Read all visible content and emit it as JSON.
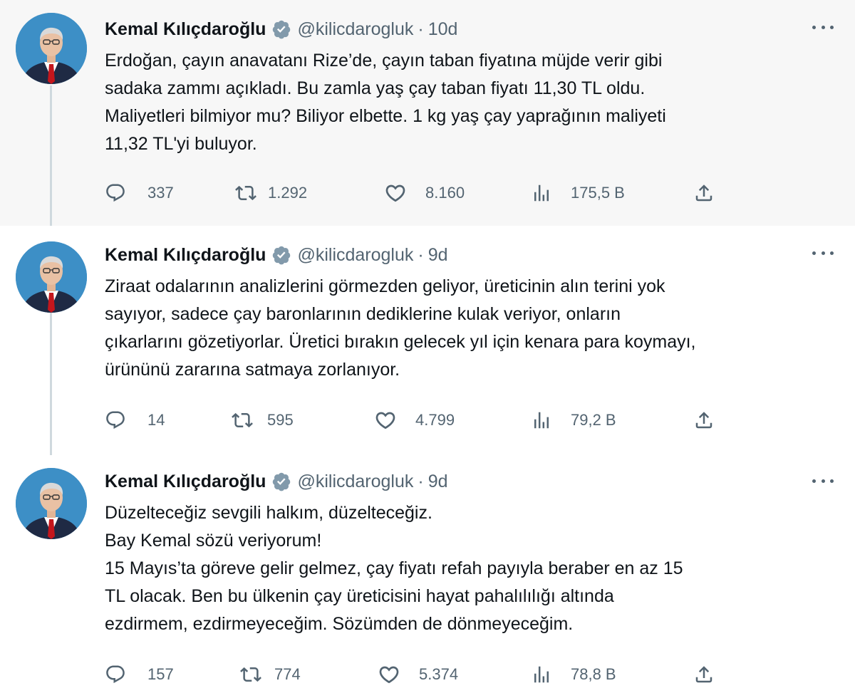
{
  "tweets": [
    {
      "author": "Kemal Kılıçdaroğlu",
      "handle": "@kilicdarogluk",
      "separator": "·",
      "time": "10d",
      "lines": [
        "Erdoğan, çayın anavatanı Rize’de, çayın taban fiyatına müjde verir gibi",
        "sadaka zammı açıkladı. Bu zamla yaş çay taban fiyatı 11,30 TL oldu.",
        "Maliyetleri bilmiyor mu? Biliyor elbette. 1 kg yaş çay yaprağının maliyeti",
        "11,32 TL'yi buluyor."
      ],
      "replies": "337",
      "retweets": "1.292",
      "likes": "8.160",
      "views": "175,5 B"
    },
    {
      "author": "Kemal Kılıçdaroğlu",
      "handle": "@kilicdarogluk",
      "separator": "·",
      "time": "9d",
      "lines": [
        "Ziraat odalarının analizlerini görmezden geliyor, üreticinin alın terini yok",
        "sayıyor, sadece çay baronlarının dediklerine kulak veriyor, onların",
        "çıkarlarını gözetiyorlar. Üretici bırakın gelecek yıl için kenara para koymayı,",
        "ürününü zararına satmaya zorlanıyor."
      ],
      "replies": "14",
      "retweets": "595",
      "likes": "4.799",
      "views": "79,2 B"
    },
    {
      "author": "Kemal Kılıçdaroğlu",
      "handle": "@kilicdarogluk",
      "separator": "·",
      "time": "9d",
      "lines": [
        "Düzelteceğiz sevgili halkım, düzelteceğiz.",
        "Bay Kemal sözü veriyorum!",
        "15 Mayıs’ta göreve gelir gelmez, çay fiyatı refah payıyla beraber en az 15",
        "TL olacak. Ben bu ülkenin çay üreticisini hayat pahalılılığı altında",
        "ezdirmem, ezdirmeyeceğim. Sözümden de dönmeyeceğim."
      ],
      "replies": "157",
      "retweets": "774",
      "likes": "5.374",
      "views": "78,8 B"
    }
  ],
  "icons": {
    "verified": "verified-badge-icon",
    "more": "more-options-icon",
    "reply": "reply-icon",
    "retweet": "retweet-icon",
    "like": "heart-icon",
    "views": "views-chart-icon",
    "share": "share-icon"
  },
  "colors": {
    "text": "#0f1419",
    "secondary": "#536471",
    "thread_line": "#cfd9de",
    "highlight_bg": "#f7f7f7",
    "verified": "#829aab",
    "avatar_bg": "#3d8fc6"
  }
}
